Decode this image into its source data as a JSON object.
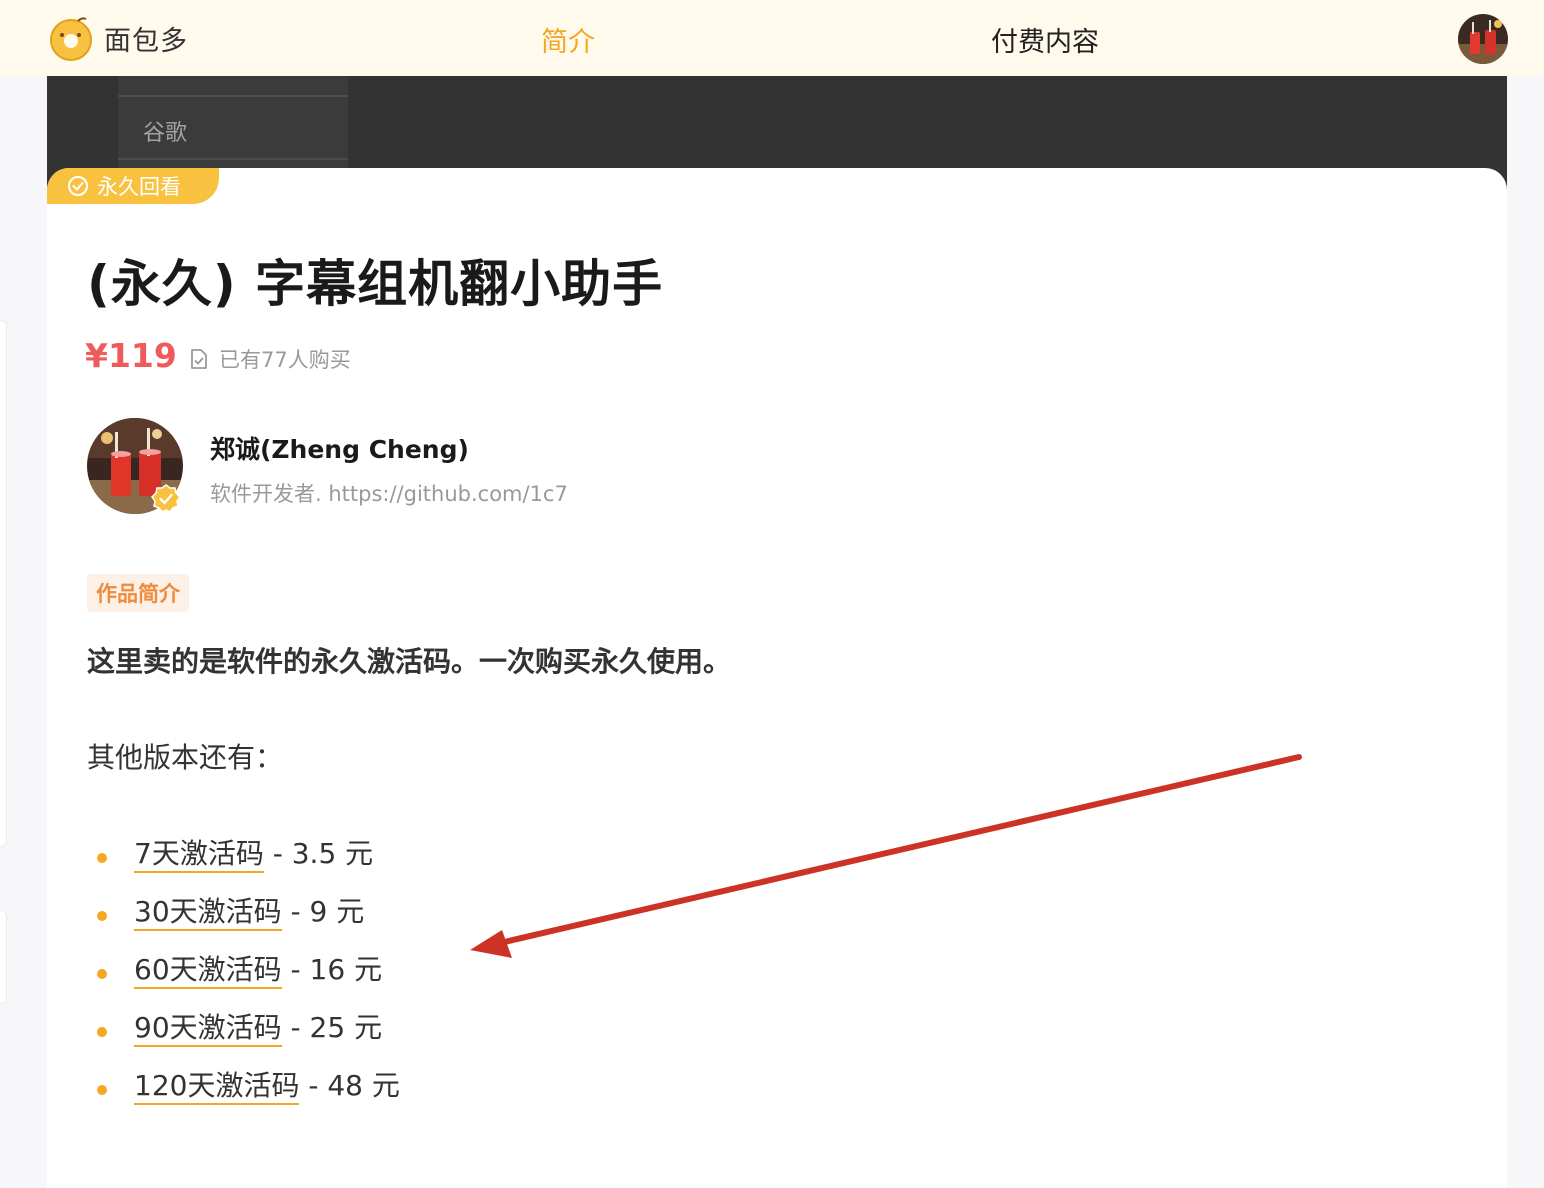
{
  "nav": {
    "brand": "面包多",
    "tabs": [
      {
        "label": "简介",
        "active": true
      },
      {
        "label": "付费内容",
        "active": false
      }
    ]
  },
  "cover": {
    "menu_item": "谷歌"
  },
  "product": {
    "badge": "永久回看",
    "title": "(永久) 字幕组机翻小助手",
    "price": "¥119",
    "buyers": "已有77人购买"
  },
  "author": {
    "name": "郑诚(Zheng Cheng)",
    "bio": "软件开发者. https://github.com/1c7"
  },
  "intro": {
    "section_label": "作品简介",
    "lead": "这里卖的是软件的永久激活码。一次购买永久使用。",
    "other_versions_label": "其他版本还有：",
    "versions": [
      {
        "link": "7天激活码",
        "price": " - 3.5 元"
      },
      {
        "link": "30天激活码",
        "price": " - 9 元"
      },
      {
        "link": "60天激活码",
        "price": " - 16 元"
      },
      {
        "link": "90天激活码",
        "price": " - 25 元"
      },
      {
        "link": "120天激活码",
        "price": " - 48 元"
      }
    ]
  },
  "colors": {
    "accent": "#f5a623",
    "price_red": "#ef5b5b",
    "nav_bg": "#fffaeb",
    "annotation_arrow": "#cc3326"
  }
}
